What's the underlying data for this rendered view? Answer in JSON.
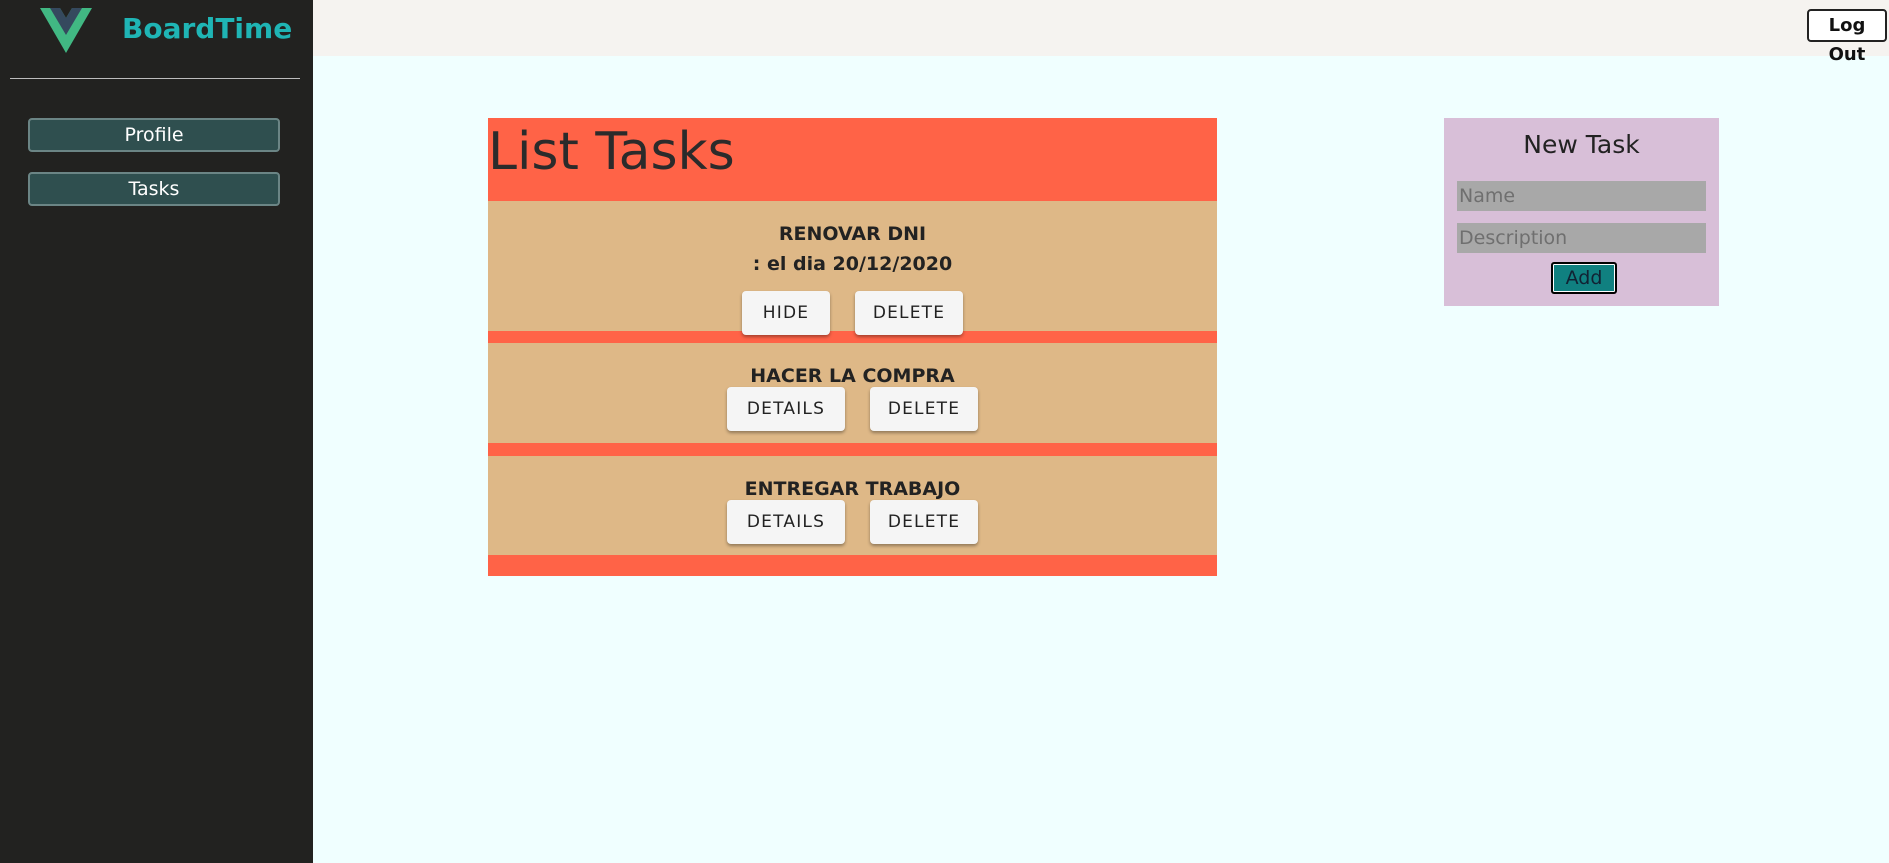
{
  "sidebar": {
    "brand_name": "BoardTime",
    "logo_icon": "vue-logo-icon",
    "items": [
      {
        "label": "Profile"
      },
      {
        "label": "Tasks"
      }
    ]
  },
  "topbar": {
    "logout_label": "Log Out"
  },
  "list": {
    "title": "List Tasks",
    "tasks": [
      {
        "title": "RENOVAR DNI",
        "detail": ": el dia 20/12/2020",
        "toggle_label": "HIDE",
        "delete_label": "DELETE"
      },
      {
        "title": "HACER LA COMPRA",
        "toggle_label": "DETAILS",
        "delete_label": "DELETE"
      },
      {
        "title": "ENTREGAR TRABAJO",
        "toggle_label": "DETAILS",
        "delete_label": "DELETE"
      }
    ]
  },
  "new_task": {
    "title": "New Task",
    "name_placeholder": "Name",
    "description_placeholder": "Description",
    "add_label": "Add"
  },
  "colors": {
    "sidebar_bg": "#222220",
    "brand": "#1fb5b5",
    "page_bg": "#f0ffff",
    "list_bg": "#ff6347",
    "task_bg": "#deb887",
    "new_task_bg": "#d8bfd8",
    "add_button": "#108080"
  }
}
